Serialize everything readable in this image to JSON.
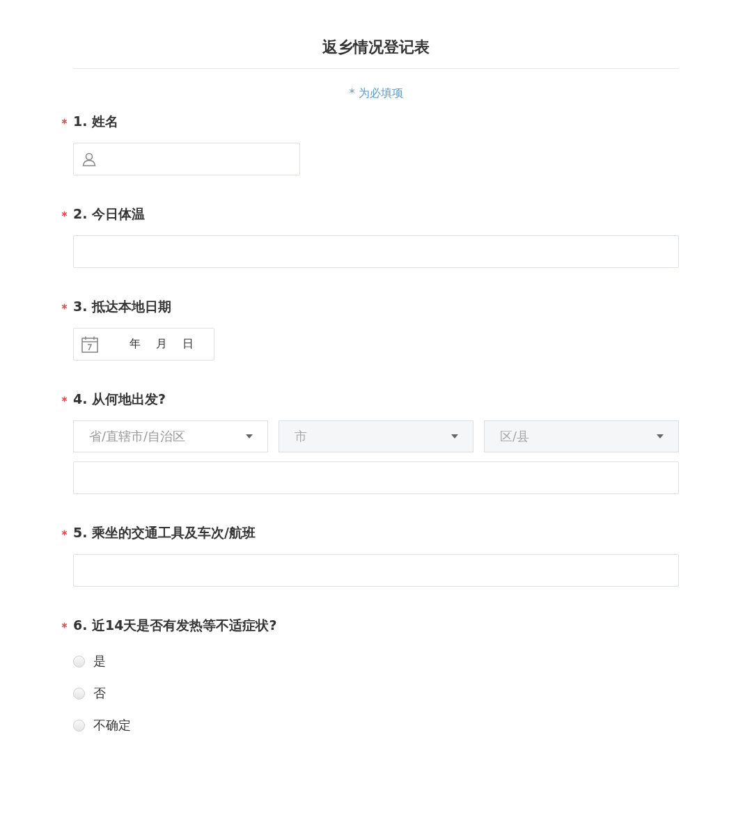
{
  "title": "返乡情况登记表",
  "required_note": "* 为必填项",
  "questions": [
    {
      "kind": "name",
      "required": true,
      "label": "1. 姓名"
    },
    {
      "kind": "text",
      "required": true,
      "label": "2. 今日体温"
    },
    {
      "kind": "date",
      "required": true,
      "label": "3. 抵达本地日期",
      "date_parts": [
        "年",
        "月",
        "日"
      ]
    },
    {
      "kind": "region",
      "required": true,
      "label": "4. 从何地出发?",
      "selects": [
        {
          "placeholder": "省/直辖市/自治区",
          "disabled": false
        },
        {
          "placeholder": "市",
          "disabled": true
        },
        {
          "placeholder": "区/县",
          "disabled": true
        }
      ]
    },
    {
      "kind": "text",
      "required": true,
      "label": "5. 乘坐的交通工具及车次/航班"
    },
    {
      "kind": "radio",
      "required": true,
      "label": "6. 近14天是否有发热等不适症状?",
      "options": [
        {
          "label": "是",
          "selected": false
        },
        {
          "label": "否",
          "selected": false
        },
        {
          "label": "不确定",
          "selected": false
        }
      ]
    }
  ]
}
